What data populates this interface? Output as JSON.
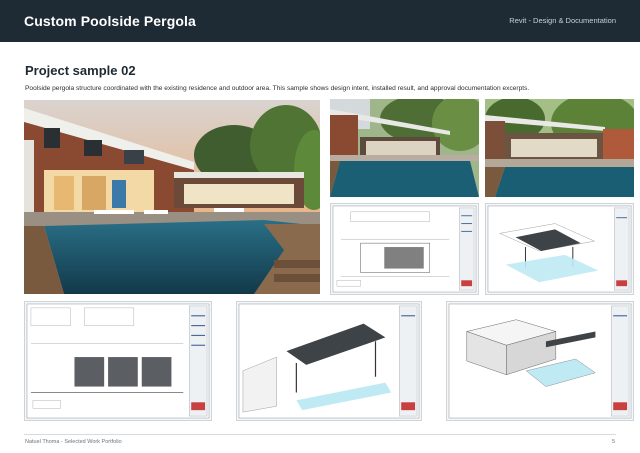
{
  "header": {
    "title": "Custom Poolside Pergola",
    "subtitle": "Revit - Design & Documentation"
  },
  "section": {
    "title": "Project sample 02",
    "description": "Poolside pergola structure coordinated with the existing residence and outdoor area. This sample shows design intent, installed result, and approval documentation excerpts."
  },
  "footer": {
    "left": "Natuel Thoma - Selected Work Portfolio",
    "page": "5"
  },
  "colors": {
    "header_bg": "#1f2b34",
    "pool_water": "#1f5e73",
    "wood_siding": "#8a4a32",
    "sky_dusk": "#e9a66f"
  },
  "images": [
    {
      "name": "hero-pool-photo",
      "kind": "photo"
    },
    {
      "name": "pool-photo-wide",
      "kind": "photo"
    },
    {
      "name": "pool-photo-pergola",
      "kind": "photo"
    },
    {
      "name": "plan-drawing-sheet",
      "kind": "drawing"
    },
    {
      "name": "isometric-pergola-sheet",
      "kind": "drawing"
    },
    {
      "name": "elevation-drawing-sheet",
      "kind": "drawing"
    },
    {
      "name": "perspective-pergola-sheet",
      "kind": "drawing"
    },
    {
      "name": "house-pool-axonometric-sheet",
      "kind": "drawing"
    }
  ]
}
